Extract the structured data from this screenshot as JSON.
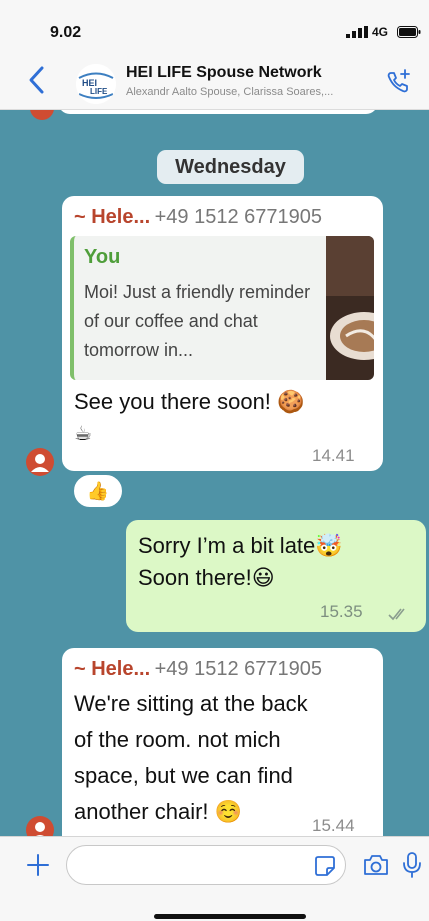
{
  "status_bar": {
    "time": "9.02",
    "network": "4G"
  },
  "header": {
    "title": "HEI LIFE Spouse Network",
    "subtitle": "Alexandr Aalto Spouse, Clarissa Soares,...",
    "logo_text_top": "HEI",
    "logo_text_bottom": "LIFE"
  },
  "chat": {
    "day_label": "Wednesday",
    "messages": [
      {
        "direction": "in",
        "sender": "~ Hele...",
        "phone": "+49 1512 6771905",
        "quote_author": "You",
        "quote_text": "Moi! Just a friendly reminder of our coffee and chat tomorrow in...",
        "text_line1": "See you there soon! 🍪",
        "text_line2": "☕",
        "time": "14.41",
        "reaction": "👍"
      },
      {
        "direction": "out",
        "text_line1": "Sorry I’m a bit late🤯",
        "text_line2": "Soon there!😃",
        "time": "15.35"
      },
      {
        "direction": "in",
        "sender": "~ Hele...",
        "phone": "+49 1512 6771905",
        "text_lines": [
          "We're sitting at the back",
          "of the room. not mich",
          "space, but we can find",
          "another chair! ☺️"
        ],
        "time": "15.44"
      }
    ]
  },
  "composer": {
    "placeholder": "",
    "value": ""
  },
  "colors": {
    "chat_bg": "#4f93a6",
    "outgoing": "#dcf8c6",
    "sender": "#b8452d",
    "accent": "#2f6fd6"
  },
  "icons": [
    "back-icon",
    "add-call-icon",
    "plus-icon",
    "sticker-icon",
    "camera-icon",
    "mic-icon",
    "read-receipt-icon",
    "signal-icon",
    "battery-icon"
  ]
}
